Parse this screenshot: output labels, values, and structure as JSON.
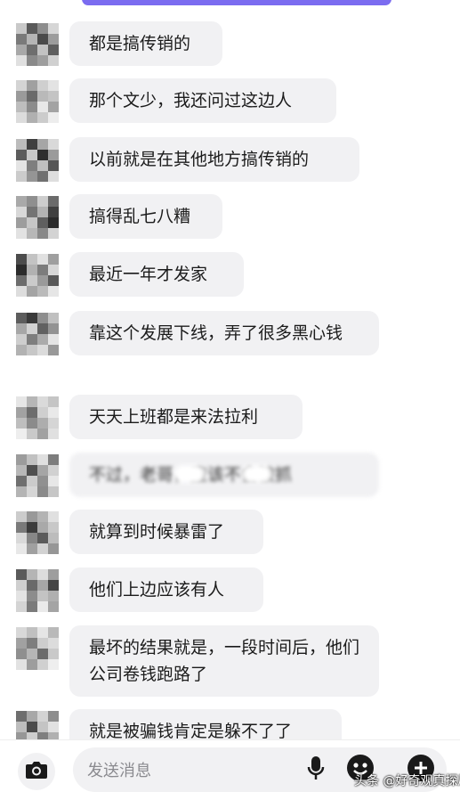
{
  "messages": [
    {
      "text": "都是搞传销的"
    },
    {
      "text": "那个文少，我还问过这边人"
    },
    {
      "text": "以前就是在其他地方搞传销的"
    },
    {
      "text": "搞得乱七八糟"
    },
    {
      "text": "最近一年才发家"
    },
    {
      "text": "靠这个发展下线，弄了很多黑心钱"
    },
    {
      "text": "天天上班都是来法拉利"
    },
    {
      "text": "不过，老哥，应该不会被抓"
    },
    {
      "text": "就算到时候暴雷了"
    },
    {
      "text": "他们上边应该有人"
    },
    {
      "text": "最坏的结果就是，一段时间后，他们公司卷钱跑路了"
    },
    {
      "text": "就是被骗钱肯定是躲不了了"
    }
  ],
  "composer": {
    "placeholder": "发送消息",
    "icons": [
      "camera-icon",
      "microphone-icon",
      "emoji-icon",
      "plus-icon"
    ]
  },
  "watermark": "头条 @好奇观真探局",
  "colors": {
    "bubble": "#f1f1f3",
    "accent": "#7b6cf0",
    "background": "#ffffff"
  }
}
